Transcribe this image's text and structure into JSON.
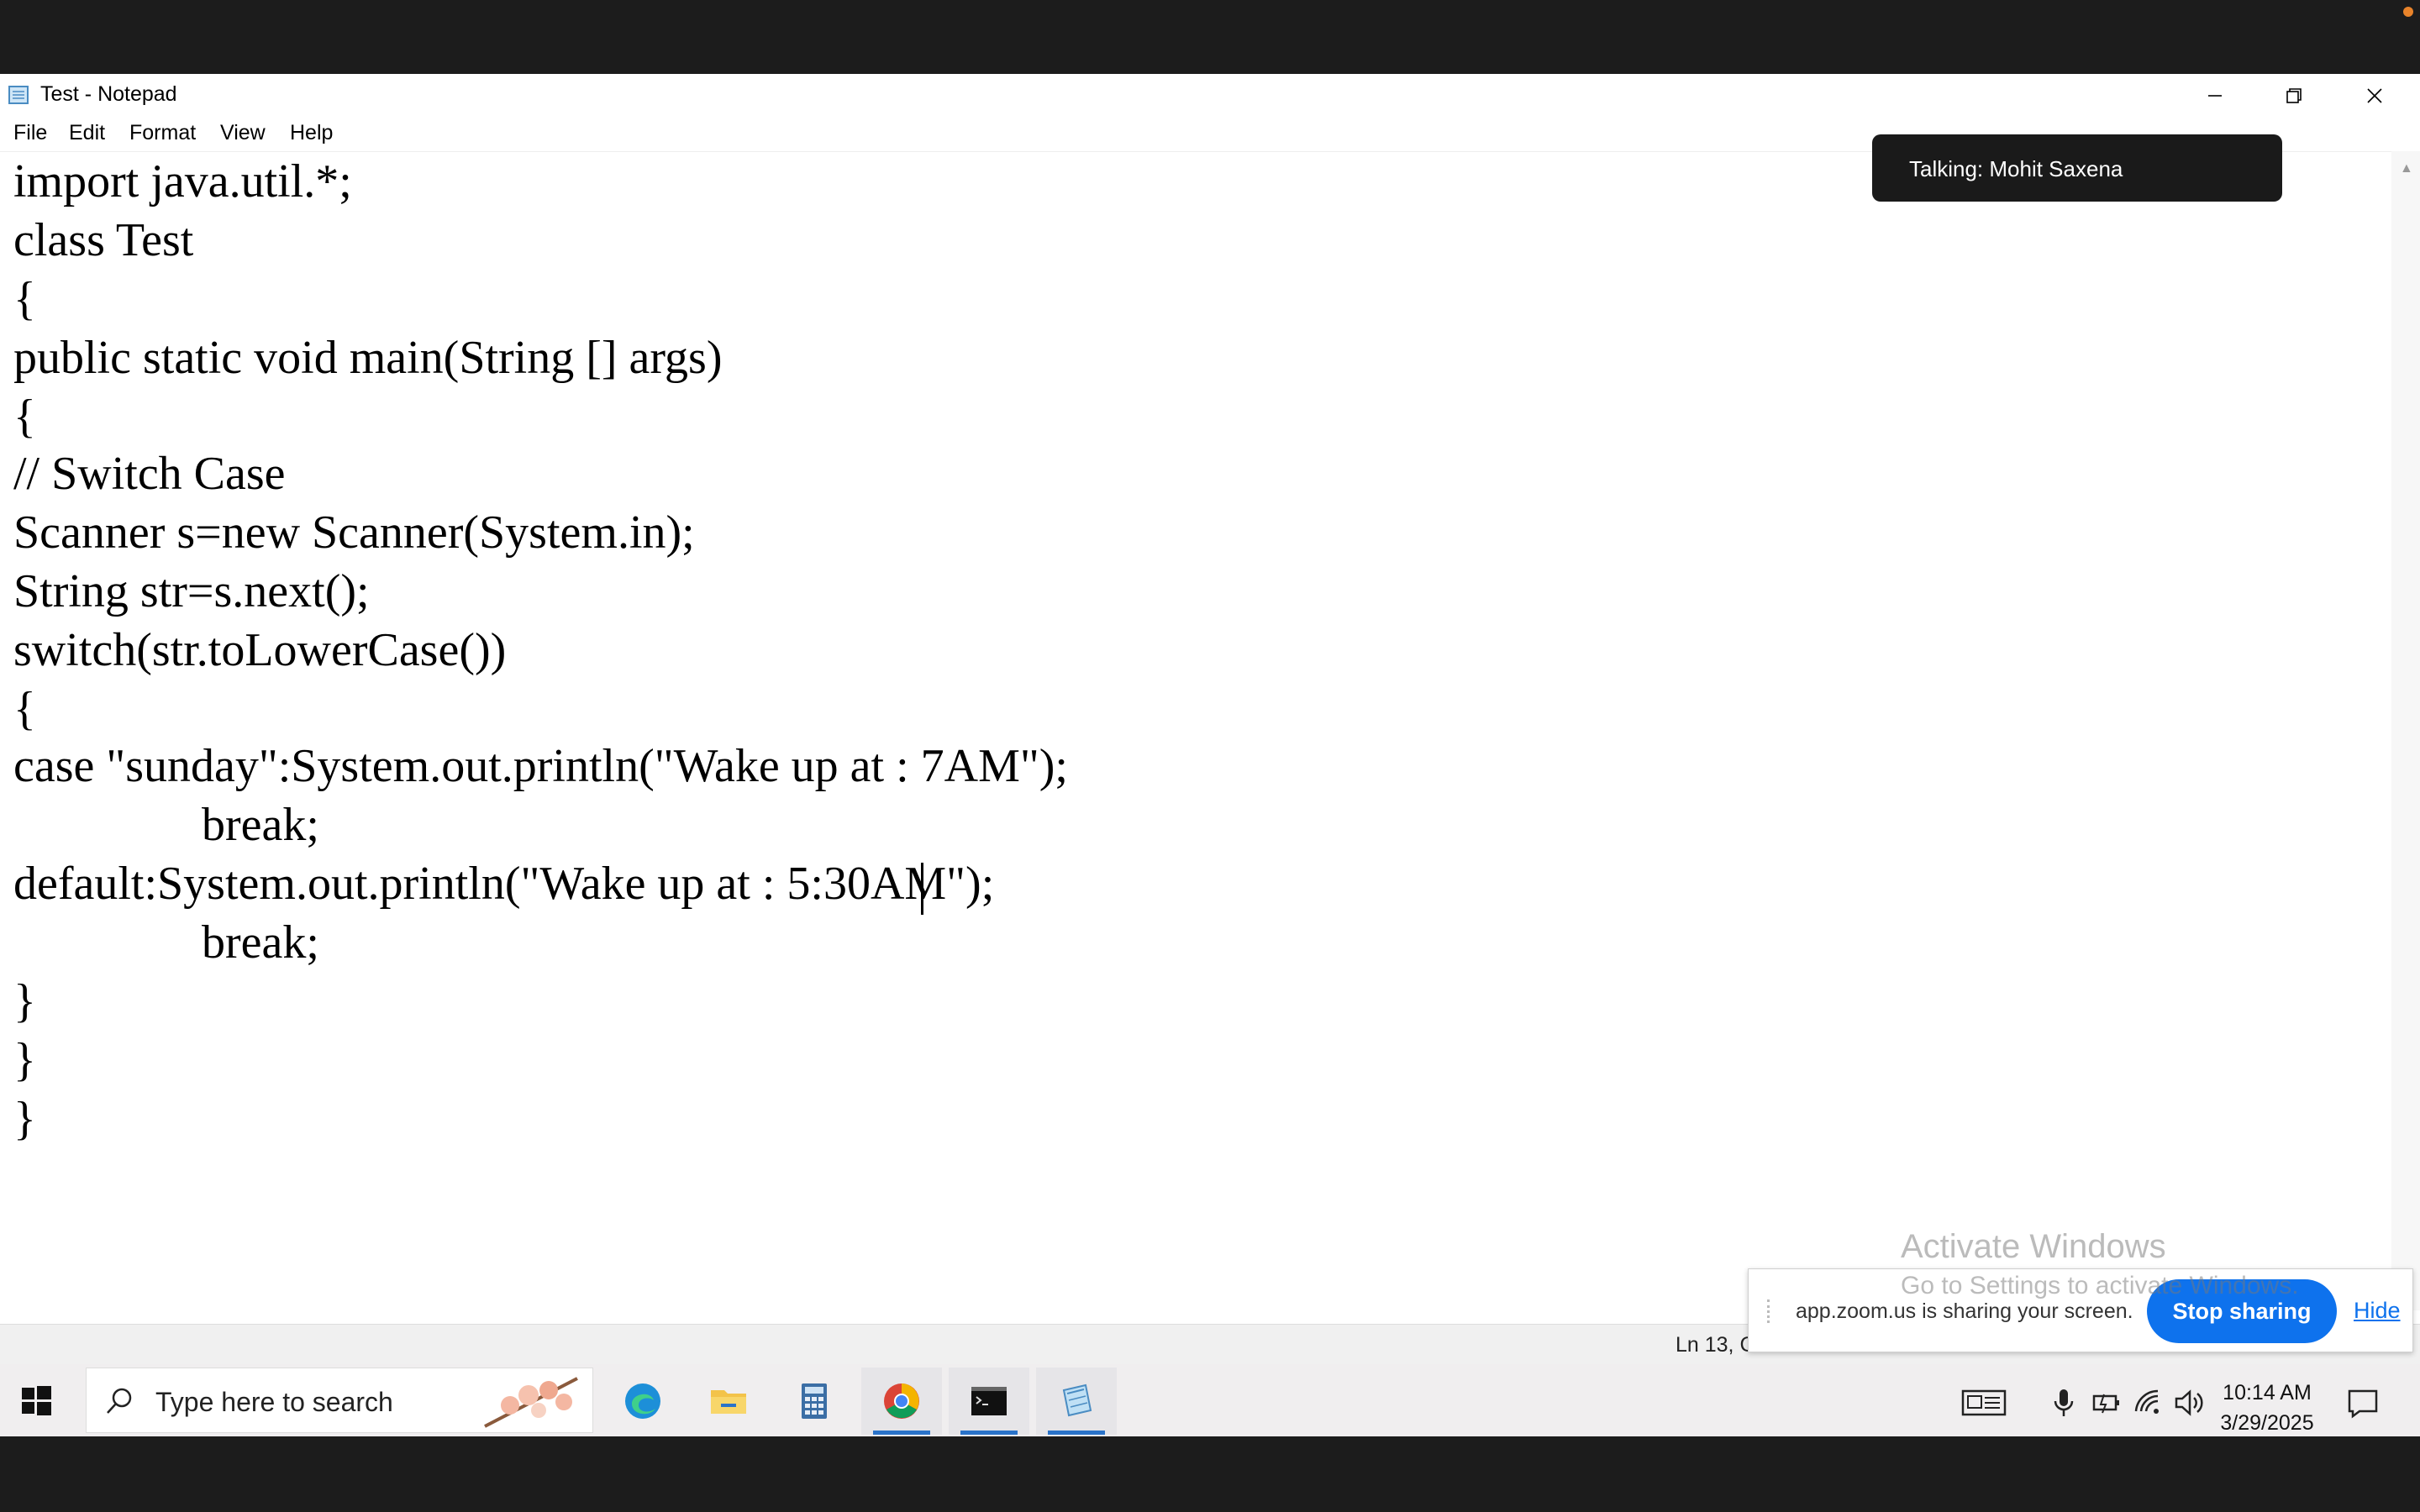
{
  "window": {
    "title": "Test - Notepad"
  },
  "menu": [
    {
      "label": "File"
    },
    {
      "label": "Edit"
    },
    {
      "label": "Format"
    },
    {
      "label": "View"
    },
    {
      "label": "Help"
    }
  ],
  "code_lines": [
    "import java.util.*;",
    "class Test",
    "{",
    "public static void main(String [] args)",
    "{",
    "// Switch Case",
    "Scanner s=new Scanner(System.in);",
    "String str=s.next();",
    "switch(str.toLowerCase())",
    "{",
    "case \"sunday\":System.out.println(\"Wake up at : 7AM\");",
    "                break;",
    "default:System.out.println(\"Wake up at : 5:30AM\");",
    "                break;",
    "}",
    "}",
    "}"
  ],
  "status": {
    "position": "Ln 13, C"
  },
  "zoom": {
    "talking": "Talking: Mohit Saxena",
    "sharing_message": "app.zoom.us is sharing your screen.",
    "stop_label": "Stop sharing",
    "hide_label": "Hide"
  },
  "watermark": {
    "line1": "Activate Windows",
    "line2": "Go to Settings to activate Windows."
  },
  "taskbar": {
    "search_placeholder": "Type here to search",
    "apps": [
      {
        "name": "Microsoft Edge",
        "icon": "edge-icon"
      },
      {
        "name": "File Explorer",
        "icon": "folder-icon"
      },
      {
        "name": "Calculator",
        "icon": "calculator-icon"
      },
      {
        "name": "Google Chrome",
        "icon": "chrome-icon"
      },
      {
        "name": "Command Prompt",
        "icon": "terminal-icon"
      },
      {
        "name": "Notepad",
        "icon": "notepad-icon"
      }
    ],
    "time": "10:14 AM",
    "date": "3/29/2025"
  },
  "colors": {
    "zoom_blue": "#0e72ed",
    "taskbar_active_underline": "#2a73c9",
    "camera_indicator": "#e8832a"
  }
}
